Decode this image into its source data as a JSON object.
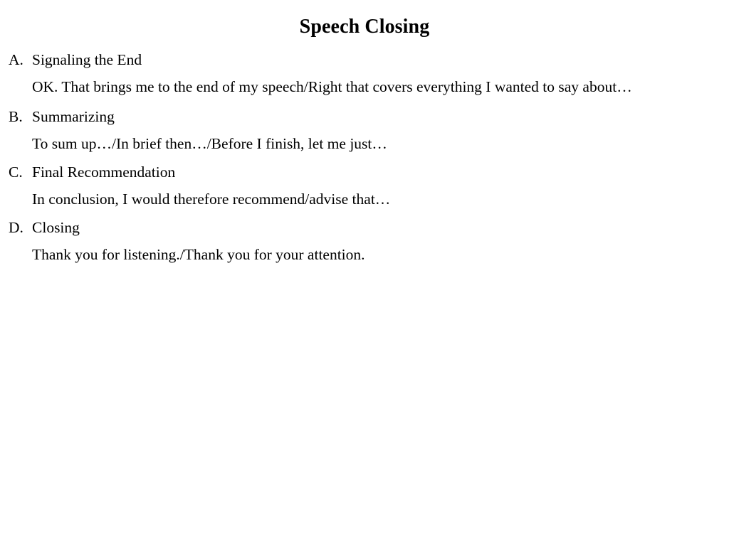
{
  "slide": {
    "title": "Speech Closing",
    "background_color": "#ffffff",
    "text_color": "#000000",
    "entries": [
      {
        "marker": "A.",
        "label": "Signaling the End",
        "body": "OK. That brings me to the end of my speech/Right that covers everything I wanted to say about…"
      },
      {
        "marker": "B.",
        "label": "Summarizing",
        "body": "To sum up…/In brief then…/Before I finish, let me just…"
      },
      {
        "marker": "C.",
        "label": "Final Recommendation",
        "body": "In conclusion, I would therefore recommend/advise that…"
      },
      {
        "marker": "D.",
        "label": "Closing",
        "body": "Thank you for listening./Thank you for your attention."
      }
    ]
  }
}
